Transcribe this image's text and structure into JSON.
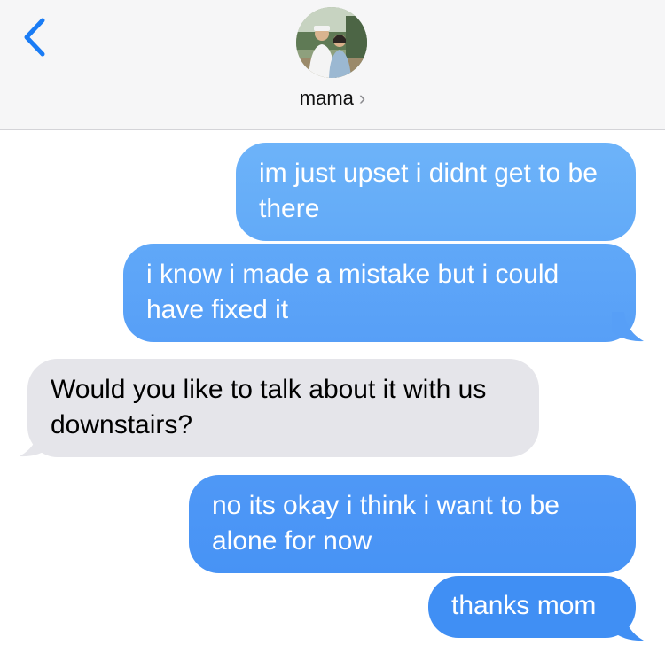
{
  "header": {
    "back_icon": "chevron-left-icon",
    "contact_name": "mama",
    "contact_chevron": "›"
  },
  "messages": [
    {
      "direction": "outgoing",
      "text": "im just upset i didnt get to be there"
    },
    {
      "direction": "outgoing",
      "text": "i know i made a mistake but i could have fixed it"
    },
    {
      "direction": "incoming",
      "text": "Would you like to talk about it with us downstairs?"
    },
    {
      "direction": "outgoing",
      "text": "no its okay i think i want to be alone for now"
    },
    {
      "direction": "outgoing",
      "text": "thanks mom"
    }
  ],
  "colors": {
    "header_bg": "#f6f6f7",
    "accent_blue": "#1a7cf5",
    "outgoing_top": "#6ab0f8",
    "outgoing_bottom": "#3e8ef4",
    "incoming_bg": "#e5e5ea"
  }
}
